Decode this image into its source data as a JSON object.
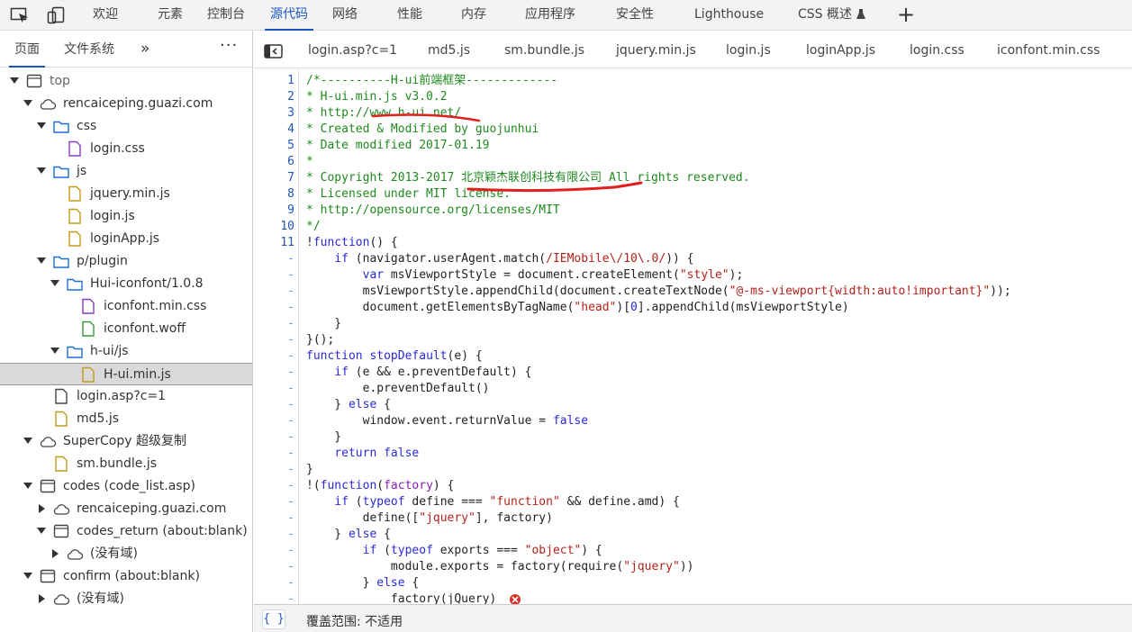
{
  "toolbar": {
    "tabs": [
      "欢迎",
      "元素",
      "控制台",
      "源代码",
      "网络",
      "性能",
      "内存",
      "应用程序",
      "安全性",
      "Lighthouse",
      "CSS 概述"
    ],
    "active_tab": "源代码",
    "add_tab_label": "+"
  },
  "sidebar": {
    "tabs": [
      "页面",
      "文件系统"
    ],
    "more_label": "»",
    "menu_label": "⋮",
    "tree": [
      {
        "label": "top",
        "indent": 0,
        "arrow": "down",
        "icon": "frame"
      },
      {
        "label": "rencaiceping.guazi.com",
        "indent": 1,
        "arrow": "down",
        "icon": "cloud"
      },
      {
        "label": "css",
        "indent": 2,
        "arrow": "down",
        "icon": "folder"
      },
      {
        "label": "login.css",
        "indent": 3,
        "arrow": "",
        "icon": "file-css"
      },
      {
        "label": "js",
        "indent": 2,
        "arrow": "down",
        "icon": "folder"
      },
      {
        "label": "jquery.min.js",
        "indent": 3,
        "arrow": "",
        "icon": "file-js"
      },
      {
        "label": "login.js",
        "indent": 3,
        "arrow": "",
        "icon": "file-js"
      },
      {
        "label": "loginApp.js",
        "indent": 3,
        "arrow": "",
        "icon": "file-js"
      },
      {
        "label": "p/plugin",
        "indent": 2,
        "arrow": "down",
        "icon": "folder"
      },
      {
        "label": "Hui-iconfont/1.0.8",
        "indent": 3,
        "arrow": "down",
        "icon": "folder"
      },
      {
        "label": "iconfont.min.css",
        "indent": 4,
        "arrow": "",
        "icon": "file-css"
      },
      {
        "label": "iconfont.woff",
        "indent": 4,
        "arrow": "",
        "icon": "file-font"
      },
      {
        "label": "h-ui/js",
        "indent": 3,
        "arrow": "down",
        "icon": "folder"
      },
      {
        "label": "H-ui.min.js",
        "indent": 4,
        "arrow": "",
        "icon": "file-js",
        "selected": true
      },
      {
        "label": "login.asp?c=1",
        "indent": 2,
        "arrow": "",
        "icon": "file-doc"
      },
      {
        "label": "md5.js",
        "indent": 2,
        "arrow": "",
        "icon": "file-js"
      },
      {
        "label": "SuperCopy 超级复制",
        "indent": 1,
        "arrow": "down",
        "icon": "cloud"
      },
      {
        "label": "sm.bundle.js",
        "indent": 2,
        "arrow": "",
        "icon": "file-js"
      },
      {
        "label": "codes (code_list.asp)",
        "indent": 1,
        "arrow": "down",
        "icon": "frame"
      },
      {
        "label": "rencaiceping.guazi.com",
        "indent": 2,
        "arrow": "right",
        "icon": "cloud"
      },
      {
        "label": "codes_return (about:blank)",
        "indent": 2,
        "arrow": "down",
        "icon": "frame"
      },
      {
        "label": "(没有域)",
        "indent": 3,
        "arrow": "right",
        "icon": "cloud"
      },
      {
        "label": "confirm (about:blank)",
        "indent": 1,
        "arrow": "down",
        "icon": "frame"
      },
      {
        "label": "(没有域)",
        "indent": 2,
        "arrow": "right",
        "icon": "cloud"
      }
    ]
  },
  "editor": {
    "tabs": [
      "login.asp?c=1",
      "md5.js",
      "sm.bundle.js",
      "jquery.min.js",
      "login.js",
      "loginApp.js",
      "login.css",
      "iconfont.min.css"
    ],
    "line_numbers": [
      "1",
      "2",
      "3",
      "4",
      "5",
      "6",
      "7",
      "8",
      "9",
      "10",
      "11",
      "-",
      "-",
      "-",
      "-",
      "-",
      "-",
      "-",
      "-",
      "-",
      "-",
      "-",
      "-",
      "-",
      "-",
      "-",
      "-",
      "-",
      "-",
      "-",
      "-",
      "-",
      "-"
    ],
    "lines": [
      [
        [
          "cm",
          "/*----------H-ui前端框架-------------"
        ]
      ],
      [
        [
          "cm",
          "* H-ui.min.js v3.0.2"
        ]
      ],
      [
        [
          "cm",
          "* http://www.h-ui.net/"
        ]
      ],
      [
        [
          "cm",
          "* Created & Modified by guojunhui"
        ]
      ],
      [
        [
          "cm",
          "* Date modified 2017-01.19"
        ]
      ],
      [
        [
          "cm",
          "*"
        ]
      ],
      [
        [
          "cm",
          "* Copyright 2013-2017 北京颖杰联创科技有限公司 All rights reserved."
        ]
      ],
      [
        [
          "cm",
          "* Licensed under MIT license."
        ]
      ],
      [
        [
          "cm",
          "* http://opensource.org/licenses/MIT"
        ]
      ],
      [
        [
          "cm",
          "*/"
        ]
      ],
      [
        [
          "",
          "!"
        ],
        [
          "kw",
          "function"
        ],
        [
          "",
          "() {"
        ]
      ],
      [
        [
          "",
          "    "
        ],
        [
          "kw",
          "if"
        ],
        [
          "",
          " (navigator.userAgent.match("
        ],
        [
          "st",
          "/IEMobile\\/10\\.0/"
        ],
        [
          "",
          ")) {"
        ]
      ],
      [
        [
          "",
          "        "
        ],
        [
          "kw",
          "var"
        ],
        [
          "",
          " msViewportStyle = document.createElement("
        ],
        [
          "st",
          "\"style\""
        ],
        [
          "",
          ");"
        ]
      ],
      [
        [
          "",
          "        msViewportStyle.appendChild(document.createTextNode("
        ],
        [
          "st",
          "\"@-ms-viewport{width:auto!important}\""
        ],
        [
          "",
          "));"
        ]
      ],
      [
        [
          "",
          "        document.getElementsByTagName("
        ],
        [
          "st",
          "\"head\""
        ],
        [
          "",
          ")["
        ],
        [
          "kw",
          "0"
        ],
        [
          "",
          "].appendChild(msViewportStyle)"
        ]
      ],
      [
        [
          "",
          "    }"
        ]
      ],
      [
        [
          "",
          "}();"
        ]
      ],
      [
        [
          "kw",
          "function"
        ],
        [
          "",
          " "
        ],
        [
          "fn",
          "stopDefault"
        ],
        [
          "",
          "(e) {"
        ]
      ],
      [
        [
          "",
          "    "
        ],
        [
          "kw",
          "if"
        ],
        [
          "",
          " (e && e.preventDefault) {"
        ]
      ],
      [
        [
          "",
          "        e.preventDefault()"
        ]
      ],
      [
        [
          "",
          "    } "
        ],
        [
          "kw",
          "else"
        ],
        [
          "",
          " {"
        ]
      ],
      [
        [
          "",
          "        window.event.returnValue = "
        ],
        [
          "kw",
          "false"
        ]
      ],
      [
        [
          "",
          "    }"
        ]
      ],
      [
        [
          "",
          "    "
        ],
        [
          "kw",
          "return"
        ],
        [
          "",
          " "
        ],
        [
          "kw",
          "false"
        ]
      ],
      [
        [
          "",
          "}"
        ]
      ],
      [
        [
          "",
          "!("
        ],
        [
          "kw",
          "function"
        ],
        [
          "",
          "("
        ],
        [
          "fx",
          "factory"
        ],
        [
          "",
          ") {"
        ]
      ],
      [
        [
          "",
          "    "
        ],
        [
          "kw",
          "if"
        ],
        [
          "",
          " ("
        ],
        [
          "kw",
          "typeof"
        ],
        [
          "",
          " define === "
        ],
        [
          "st",
          "\"function\""
        ],
        [
          "",
          " && define.amd) {"
        ]
      ],
      [
        [
          "",
          "        define(["
        ],
        [
          "st",
          "\"jquery\""
        ],
        [
          "",
          "], factory)"
        ]
      ],
      [
        [
          "",
          "    } "
        ],
        [
          "kw",
          "else"
        ],
        [
          "",
          " {"
        ]
      ],
      [
        [
          "",
          "        "
        ],
        [
          "kw",
          "if"
        ],
        [
          "",
          " ("
        ],
        [
          "kw",
          "typeof"
        ],
        [
          "",
          " exports === "
        ],
        [
          "st",
          "\"object\""
        ],
        [
          "",
          ") {"
        ]
      ],
      [
        [
          "",
          "            module.exports = factory(require("
        ],
        [
          "st",
          "\"jquery\""
        ],
        [
          "",
          "))"
        ]
      ],
      [
        [
          "",
          "        } "
        ],
        [
          "kw",
          "else"
        ],
        [
          "",
          " {"
        ]
      ],
      [
        [
          "",
          "            factory(jQuery)"
        ]
      ]
    ]
  },
  "statusbar": {
    "format_label": "{ }",
    "coverage_text": "覆盖范围: 不适用"
  },
  "colors": {
    "accent": "#1a56c4",
    "annotation_red": "#e0201e",
    "error_red": "#d93025"
  }
}
